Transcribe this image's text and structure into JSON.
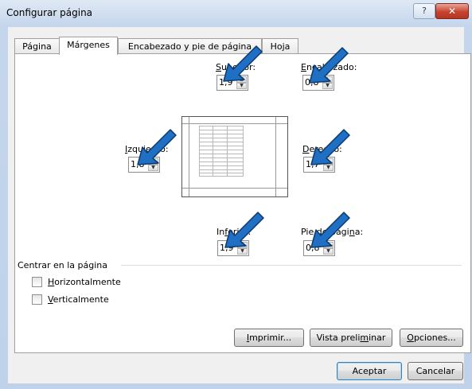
{
  "window": {
    "title": "Configurar página",
    "help_glyph": "?",
    "close_glyph": "✕"
  },
  "tabs": [
    {
      "label": "Página",
      "active": false
    },
    {
      "label": "Márgenes",
      "active": true
    },
    {
      "label": "Encabezado y pie de página",
      "active": false
    },
    {
      "label": "Hoja",
      "active": false
    }
  ],
  "margins": {
    "superior": {
      "label_pre": "",
      "label_key": "S",
      "label_post": "uperior:",
      "value": "1,9"
    },
    "encabezado": {
      "label_pre": "",
      "label_key": "E",
      "label_post": "ncabezado:",
      "value": "0,8"
    },
    "izquierdo": {
      "label_pre": "",
      "label_key": "I",
      "label_post": "zquierdo:",
      "value": "1,8"
    },
    "derecho": {
      "label_pre": "",
      "label_key": "D",
      "label_post": "erecho:",
      "value": "1,7"
    },
    "inferior": {
      "label_pre": "In",
      "label_key": "f",
      "label_post": "erior:",
      "value": "1,9"
    },
    "pie": {
      "label_pre": "Pie de pági",
      "label_key": "n",
      "label_post": "a:",
      "value": "0,8"
    }
  },
  "center": {
    "section_label": "Centrar en la página",
    "horizontal": {
      "key": "H",
      "rest": "orizontalmente",
      "checked": false
    },
    "vertical": {
      "key": "V",
      "rest": "erticalmente",
      "checked": false
    }
  },
  "buttons": {
    "imprimir": {
      "pre": "",
      "key": "I",
      "post": "mprimir..."
    },
    "vista": {
      "pre": "Vista preli",
      "key": "m",
      "post": "inar"
    },
    "opciones": {
      "pre": "",
      "key": "O",
      "post": "pciones..."
    },
    "aceptar": "Aceptar",
    "cancelar": "Cancelar"
  },
  "colors": {
    "arrow": "#1f6fc5",
    "arrow_outline": "#0c3a6b",
    "close": "#c7432f"
  }
}
